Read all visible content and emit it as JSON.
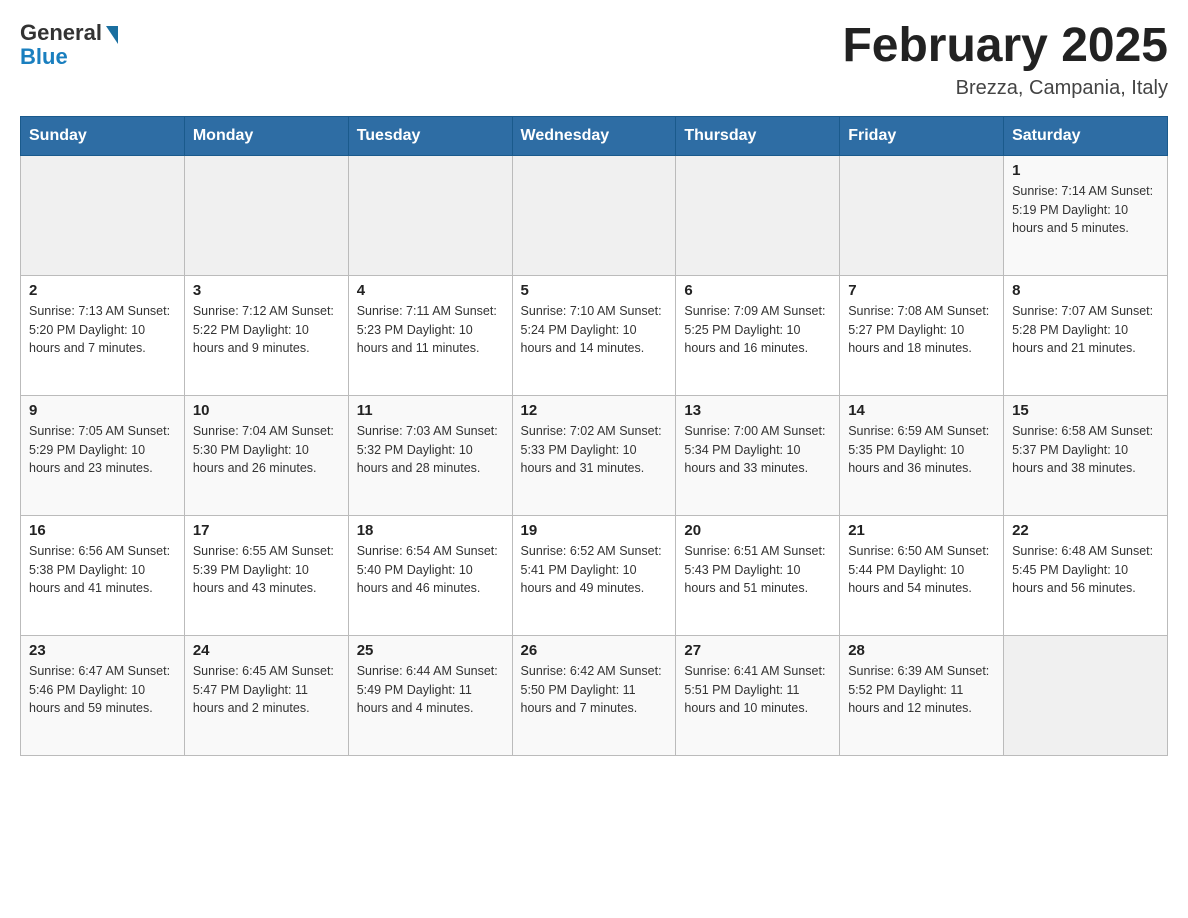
{
  "header": {
    "logo_general": "General",
    "logo_blue": "Blue",
    "month_title": "February 2025",
    "location": "Brezza, Campania, Italy"
  },
  "days_of_week": [
    "Sunday",
    "Monday",
    "Tuesday",
    "Wednesday",
    "Thursday",
    "Friday",
    "Saturday"
  ],
  "weeks": [
    [
      {
        "day": "",
        "info": ""
      },
      {
        "day": "",
        "info": ""
      },
      {
        "day": "",
        "info": ""
      },
      {
        "day": "",
        "info": ""
      },
      {
        "day": "",
        "info": ""
      },
      {
        "day": "",
        "info": ""
      },
      {
        "day": "1",
        "info": "Sunrise: 7:14 AM\nSunset: 5:19 PM\nDaylight: 10 hours and 5 minutes."
      }
    ],
    [
      {
        "day": "2",
        "info": "Sunrise: 7:13 AM\nSunset: 5:20 PM\nDaylight: 10 hours and 7 minutes."
      },
      {
        "day": "3",
        "info": "Sunrise: 7:12 AM\nSunset: 5:22 PM\nDaylight: 10 hours and 9 minutes."
      },
      {
        "day": "4",
        "info": "Sunrise: 7:11 AM\nSunset: 5:23 PM\nDaylight: 10 hours and 11 minutes."
      },
      {
        "day": "5",
        "info": "Sunrise: 7:10 AM\nSunset: 5:24 PM\nDaylight: 10 hours and 14 minutes."
      },
      {
        "day": "6",
        "info": "Sunrise: 7:09 AM\nSunset: 5:25 PM\nDaylight: 10 hours and 16 minutes."
      },
      {
        "day": "7",
        "info": "Sunrise: 7:08 AM\nSunset: 5:27 PM\nDaylight: 10 hours and 18 minutes."
      },
      {
        "day": "8",
        "info": "Sunrise: 7:07 AM\nSunset: 5:28 PM\nDaylight: 10 hours and 21 minutes."
      }
    ],
    [
      {
        "day": "9",
        "info": "Sunrise: 7:05 AM\nSunset: 5:29 PM\nDaylight: 10 hours and 23 minutes."
      },
      {
        "day": "10",
        "info": "Sunrise: 7:04 AM\nSunset: 5:30 PM\nDaylight: 10 hours and 26 minutes."
      },
      {
        "day": "11",
        "info": "Sunrise: 7:03 AM\nSunset: 5:32 PM\nDaylight: 10 hours and 28 minutes."
      },
      {
        "day": "12",
        "info": "Sunrise: 7:02 AM\nSunset: 5:33 PM\nDaylight: 10 hours and 31 minutes."
      },
      {
        "day": "13",
        "info": "Sunrise: 7:00 AM\nSunset: 5:34 PM\nDaylight: 10 hours and 33 minutes."
      },
      {
        "day": "14",
        "info": "Sunrise: 6:59 AM\nSunset: 5:35 PM\nDaylight: 10 hours and 36 minutes."
      },
      {
        "day": "15",
        "info": "Sunrise: 6:58 AM\nSunset: 5:37 PM\nDaylight: 10 hours and 38 minutes."
      }
    ],
    [
      {
        "day": "16",
        "info": "Sunrise: 6:56 AM\nSunset: 5:38 PM\nDaylight: 10 hours and 41 minutes."
      },
      {
        "day": "17",
        "info": "Sunrise: 6:55 AM\nSunset: 5:39 PM\nDaylight: 10 hours and 43 minutes."
      },
      {
        "day": "18",
        "info": "Sunrise: 6:54 AM\nSunset: 5:40 PM\nDaylight: 10 hours and 46 minutes."
      },
      {
        "day": "19",
        "info": "Sunrise: 6:52 AM\nSunset: 5:41 PM\nDaylight: 10 hours and 49 minutes."
      },
      {
        "day": "20",
        "info": "Sunrise: 6:51 AM\nSunset: 5:43 PM\nDaylight: 10 hours and 51 minutes."
      },
      {
        "day": "21",
        "info": "Sunrise: 6:50 AM\nSunset: 5:44 PM\nDaylight: 10 hours and 54 minutes."
      },
      {
        "day": "22",
        "info": "Sunrise: 6:48 AM\nSunset: 5:45 PM\nDaylight: 10 hours and 56 minutes."
      }
    ],
    [
      {
        "day": "23",
        "info": "Sunrise: 6:47 AM\nSunset: 5:46 PM\nDaylight: 10 hours and 59 minutes."
      },
      {
        "day": "24",
        "info": "Sunrise: 6:45 AM\nSunset: 5:47 PM\nDaylight: 11 hours and 2 minutes."
      },
      {
        "day": "25",
        "info": "Sunrise: 6:44 AM\nSunset: 5:49 PM\nDaylight: 11 hours and 4 minutes."
      },
      {
        "day": "26",
        "info": "Sunrise: 6:42 AM\nSunset: 5:50 PM\nDaylight: 11 hours and 7 minutes."
      },
      {
        "day": "27",
        "info": "Sunrise: 6:41 AM\nSunset: 5:51 PM\nDaylight: 11 hours and 10 minutes."
      },
      {
        "day": "28",
        "info": "Sunrise: 6:39 AM\nSunset: 5:52 PM\nDaylight: 11 hours and 12 minutes."
      },
      {
        "day": "",
        "info": ""
      }
    ]
  ]
}
